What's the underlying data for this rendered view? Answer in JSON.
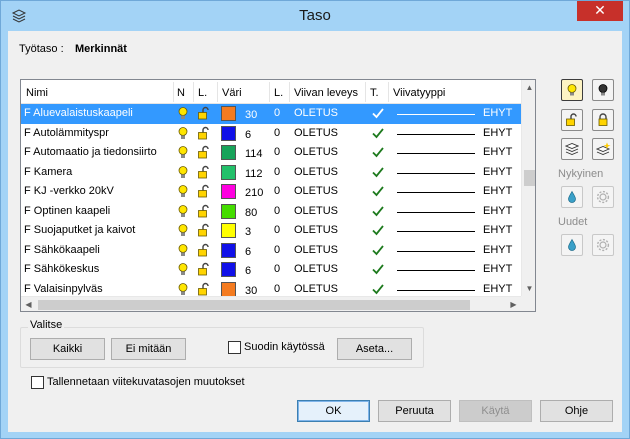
{
  "window": {
    "title": "Taso",
    "close_glyph": "✕"
  },
  "worklayer": {
    "label": "Työtaso :",
    "value": "Merkinnät"
  },
  "grid": {
    "columns": {
      "name": "Nimi",
      "visible": "N",
      "locked": "L.",
      "color": "Väri",
      "linewidth_short": "L.",
      "linewidth": "Viivan leveys",
      "print": "T.",
      "linetype": "Viivatyyppi"
    },
    "rows": [
      {
        "name": "F Aluevalaistuskaapeli",
        "color": "#f47b20",
        "color_index": "30",
        "width": "0",
        "line_width": "OLETUS",
        "linetype": "EHYT",
        "selected": true
      },
      {
        "name": "F Autolämmityspr",
        "color": "#1010e8",
        "color_index": "6",
        "width": "0",
        "line_width": "OLETUS",
        "linetype": "EHYT",
        "selected": false
      },
      {
        "name": "F Automaatio ja tiedonsiirto",
        "color": "#17a35a",
        "color_index": "114",
        "width": "0",
        "line_width": "OLETUS",
        "linetype": "EHYT",
        "selected": false
      },
      {
        "name": "F Kamera",
        "color": "#22c06a",
        "color_index": "112",
        "width": "0",
        "line_width": "OLETUS",
        "linetype": "EHYT",
        "selected": false
      },
      {
        "name": "F KJ -verkko 20kV",
        "color": "#ff00e0",
        "color_index": "210",
        "width": "0",
        "line_width": "OLETUS",
        "linetype": "EHYT",
        "selected": false
      },
      {
        "name": "F Optinen kaapeli",
        "color": "#44dd00",
        "color_index": "80",
        "width": "0",
        "line_width": "OLETUS",
        "linetype": "EHYT",
        "selected": false
      },
      {
        "name": "F Suojaputket ja kaivot",
        "color": "#ffff00",
        "color_index": "3",
        "width": "0",
        "line_width": "OLETUS",
        "linetype": "EHYT",
        "selected": false
      },
      {
        "name": "F Sähkökaapeli",
        "color": "#1010e8",
        "color_index": "6",
        "width": "0",
        "line_width": "OLETUS",
        "linetype": "EHYT",
        "selected": false
      },
      {
        "name": "F Sähkökeskus",
        "color": "#1010e8",
        "color_index": "6",
        "width": "0",
        "line_width": "OLETUS",
        "linetype": "EHYT",
        "selected": false
      },
      {
        "name": "F Valaisinpylväs",
        "color": "#f47b20",
        "color_index": "30",
        "width": "0",
        "line_width": "OLETUS",
        "linetype": "EHYT",
        "selected": false
      }
    ]
  },
  "side": {
    "current_label": "Nykyinen",
    "new_label": "Uudet"
  },
  "select_group": {
    "title": "Valitse",
    "all_button": "Kaikki",
    "none_button": "Ei mitään",
    "filter_label": "Suodin käytössä",
    "set_button": "Aseta..."
  },
  "save_ref_label": "Tallennetaan viitekuvatasojen muutokset",
  "footer": {
    "ok": "OK",
    "cancel": "Peruuta",
    "use": "Käytä",
    "help": "Ohje"
  },
  "icons": {
    "title": "layers-icon",
    "visible": "lightbulb-icon",
    "locked": "padlock-icon",
    "print": "checkmark-icon"
  }
}
